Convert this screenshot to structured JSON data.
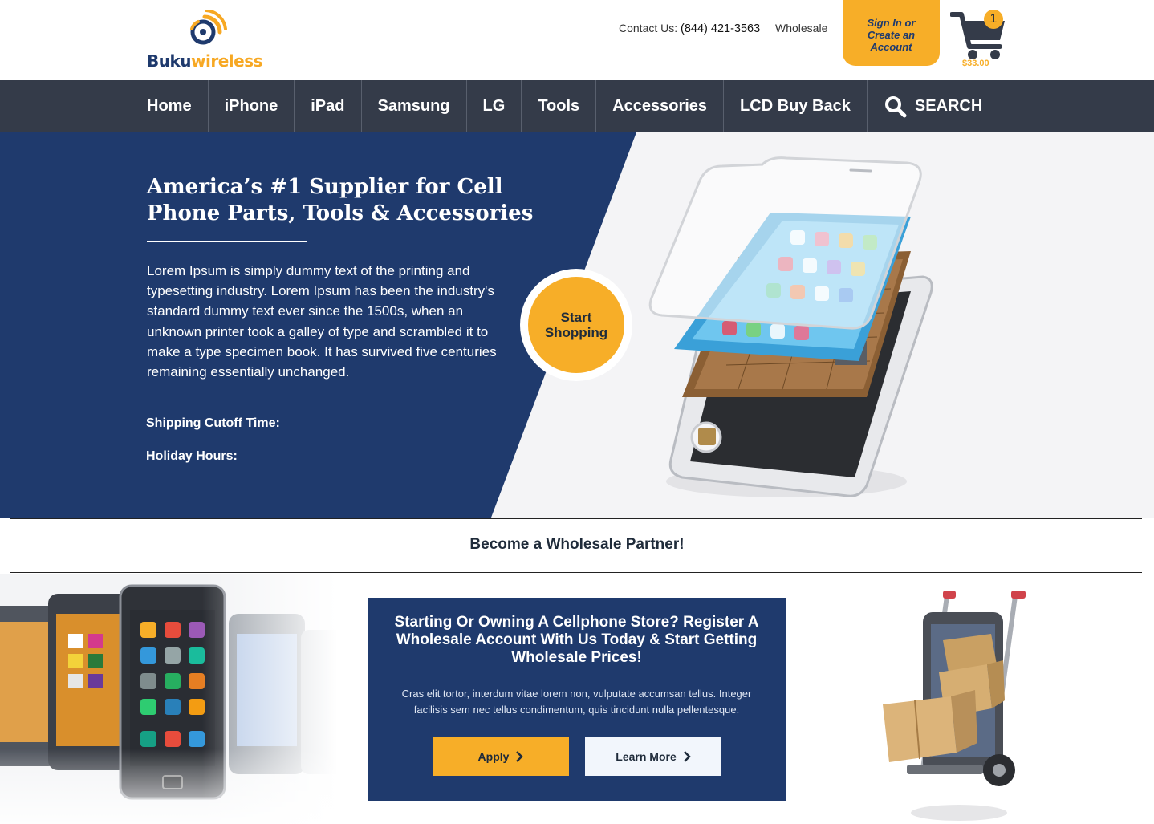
{
  "brand": {
    "name_part1": "Buku",
    "name_part2": "wireless",
    "colors": {
      "navy": "#1f3a6d",
      "orange": "#f7ae28",
      "nav_bg": "#343b49"
    }
  },
  "header": {
    "contact_label": "Contact Us:",
    "contact_phone": "(844) 421-3563",
    "wholesale_link": "Wholesale",
    "signin_label": "Sign In or Create an Account",
    "cart": {
      "count": "1",
      "total": "$33.00",
      "icon": "cart-icon"
    }
  },
  "nav": {
    "items": [
      "Home",
      "iPhone",
      "iPad",
      "Samsung",
      "LG",
      "Tools",
      "Accessories",
      "LCD Buy Back"
    ],
    "search_label": "SEARCH",
    "search_icon": "search-icon"
  },
  "hero": {
    "title": "America’s #1 Supplier for Cell Phone Parts, Tools & Accessories",
    "body": "Lorem Ipsum is simply dummy text of the printing and typesetting industry. Lorem Ipsum has been the industry's standard dummy text ever since the 1500s, when an unknown printer took a galley of type and scrambled it to make a type specimen book. It has survived five centuries remaining essentially unchanged.",
    "shipping_label": "Shipping Cutoff Time:",
    "holiday_label": "Holiday Hours:",
    "cta_label": "Start Shopping"
  },
  "wholesale": {
    "strip_title": "Become a Wholesale Partner!",
    "cta_title": "Starting Or Owning A Cellphone Store? Register A Wholesale Account With Us Today & Start Getting Wholesale Prices!",
    "cta_text": "Cras elit tortor, interdum vitae lorem non, vulputate accumsan tellus. Integer facilisis sem nec tellus condimentum, quis tincidunt nulla pellentesque.",
    "apply_label": "Apply",
    "learn_label": "Learn More"
  }
}
